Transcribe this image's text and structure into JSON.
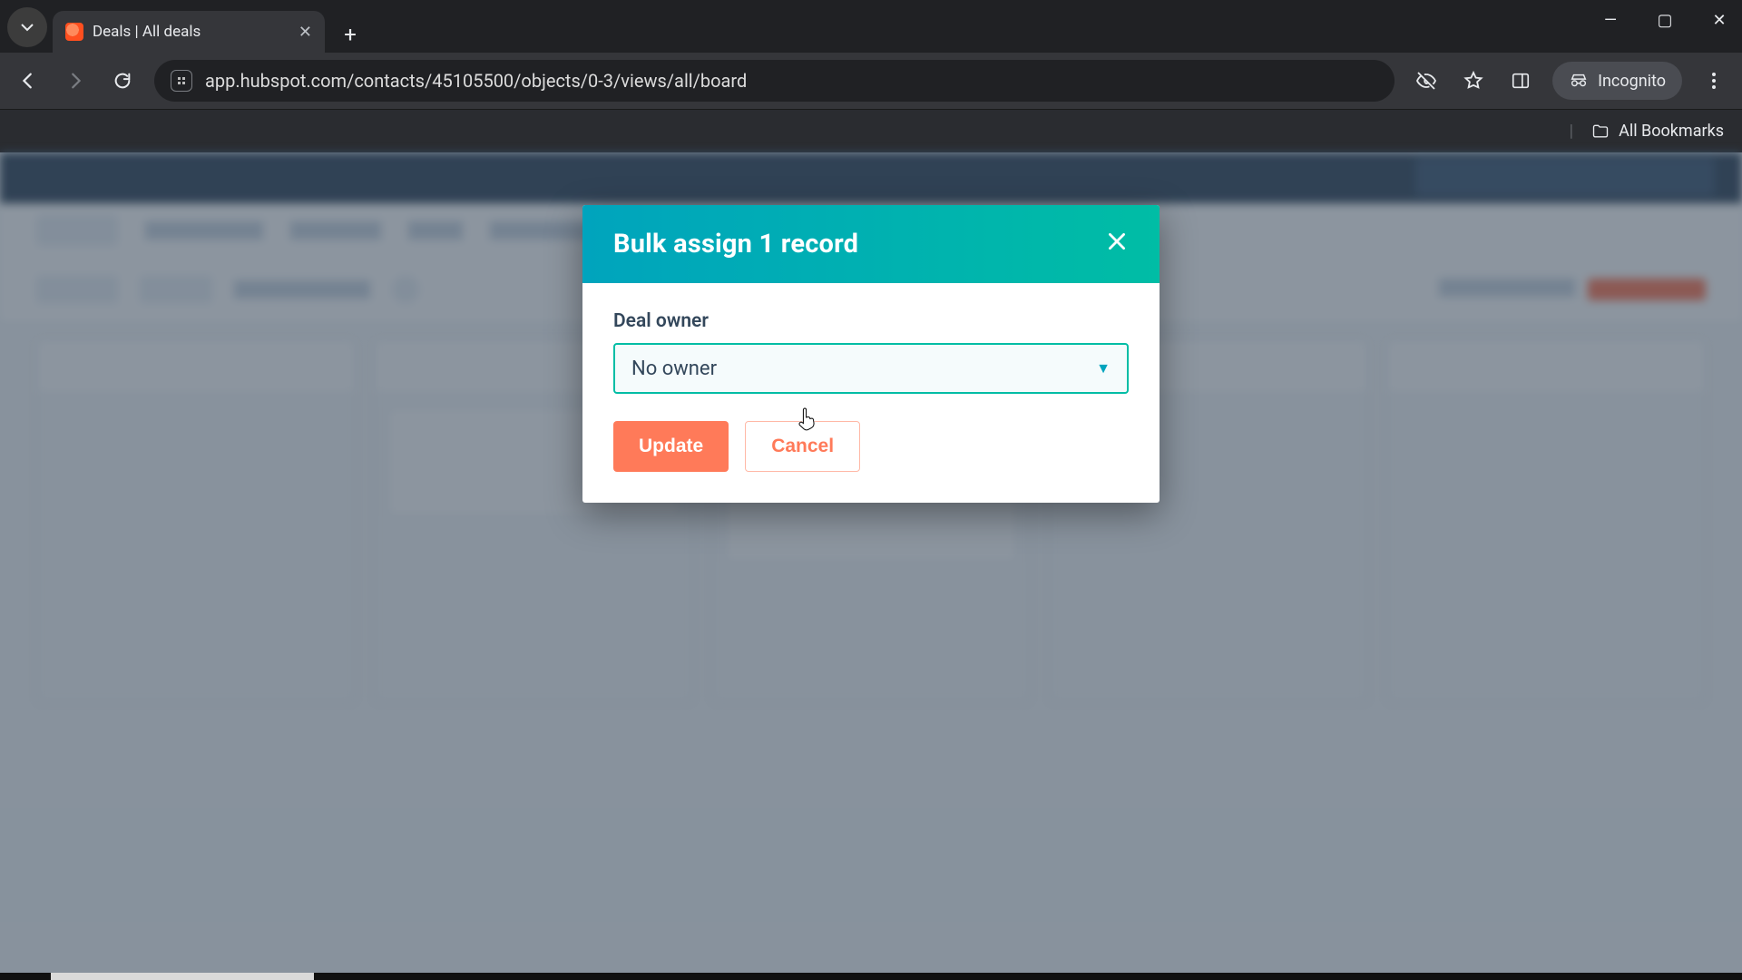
{
  "browser": {
    "tab_title": "Deals | All deals",
    "url": "app.hubspot.com/contacts/45105500/objects/0-3/views/all/board",
    "incognito_label": "Incognito",
    "all_bookmarks_label": "All Bookmarks"
  },
  "modal": {
    "title": "Bulk assign 1 record",
    "field_label": "Deal owner",
    "select_value": "No owner",
    "update_label": "Update",
    "cancel_label": "Cancel"
  }
}
